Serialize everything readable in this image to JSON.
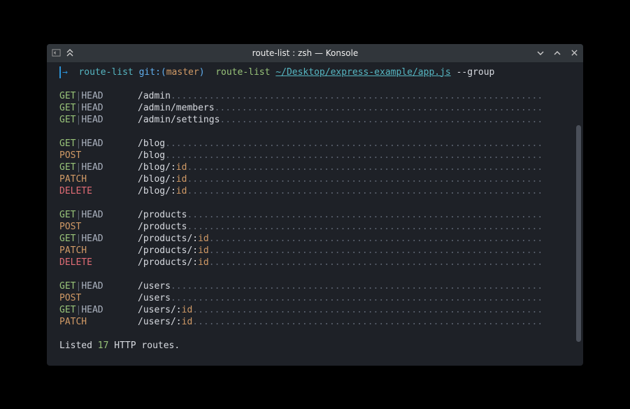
{
  "window": {
    "title": "route-list : zsh — Konsole"
  },
  "prompt": {
    "arrow": "→",
    "dir": "route-list",
    "git_label": "git:",
    "branch_open": "(",
    "branch": "master",
    "branch_close": ")",
    "cmd": "route-list",
    "path": "~/Desktop/express-example/app.js",
    "flag": " --group"
  },
  "routes": [
    [
      {
        "method": "GET",
        "head": "HEAD",
        "path": "/admin",
        "param": ""
      },
      {
        "method": "GET",
        "head": "HEAD",
        "path": "/admin/members",
        "param": ""
      },
      {
        "method": "GET",
        "head": "HEAD",
        "path": "/admin/settings",
        "param": ""
      }
    ],
    [
      {
        "method": "GET",
        "head": "HEAD",
        "path": "/blog",
        "param": ""
      },
      {
        "method": "POST",
        "head": "",
        "path": "/blog",
        "param": ""
      },
      {
        "method": "GET",
        "head": "HEAD",
        "path": "/blog/",
        "param": "id"
      },
      {
        "method": "PATCH",
        "head": "",
        "path": "/blog/",
        "param": "id"
      },
      {
        "method": "DELETE",
        "head": "",
        "path": "/blog/",
        "param": "id"
      }
    ],
    [
      {
        "method": "GET",
        "head": "HEAD",
        "path": "/products",
        "param": ""
      },
      {
        "method": "POST",
        "head": "",
        "path": "/products",
        "param": ""
      },
      {
        "method": "GET",
        "head": "HEAD",
        "path": "/products/",
        "param": "id"
      },
      {
        "method": "PATCH",
        "head": "",
        "path": "/products/",
        "param": "id"
      },
      {
        "method": "DELETE",
        "head": "",
        "path": "/products/",
        "param": "id"
      }
    ],
    [
      {
        "method": "GET",
        "head": "HEAD",
        "path": "/users",
        "param": ""
      },
      {
        "method": "POST",
        "head": "",
        "path": "/users",
        "param": ""
      },
      {
        "method": "GET",
        "head": "HEAD",
        "path": "/users/",
        "param": "id"
      },
      {
        "method": "PATCH",
        "head": "",
        "path": "/users/",
        "param": "id"
      }
    ]
  ],
  "summary": {
    "prefix": "Listed ",
    "count": "17",
    "suffix": " HTTP routes."
  },
  "method_colors": {
    "GET": "#98c379",
    "POST": "#d19a66",
    "PATCH": "#d19a66",
    "DELETE": "#e06c75",
    "HEAD": "#abb2bf"
  }
}
